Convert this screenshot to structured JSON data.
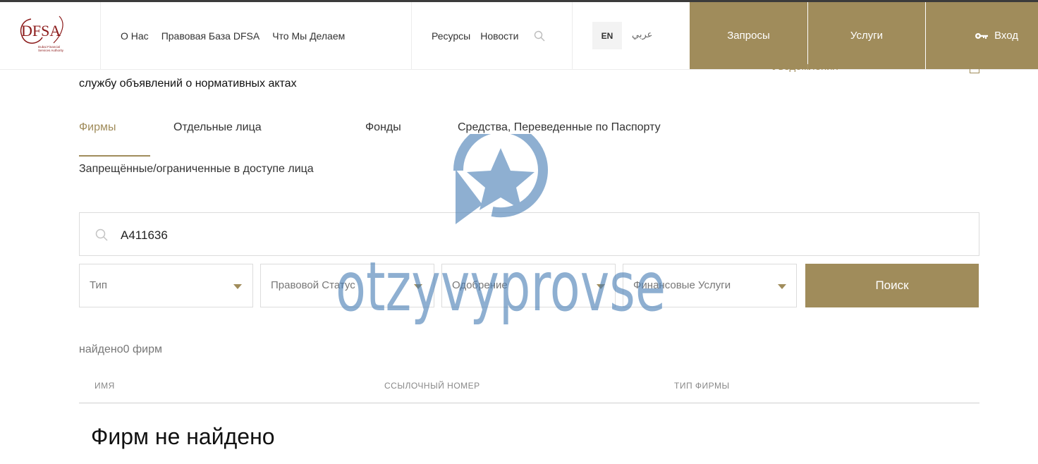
{
  "header": {
    "logo_text": "DFSA",
    "logo_subtext": "Dubai Financial Services Authority",
    "nav_left": [
      "О Нас",
      "Правовая База DFSA",
      "Что Мы Делаем"
    ],
    "nav_mid": [
      "Ресурсы",
      "Новости"
    ],
    "lang_en": "EN",
    "lang_ar": "عربي",
    "btn_requests": "Запросы",
    "btn_services": "Услуги",
    "btn_login": "Вход"
  },
  "behind_header": {
    "notifications": "Уведомления"
  },
  "subtitle": "службу объявлений о нормативных актах",
  "tabs": [
    "Фирмы",
    "Отдельные лица",
    "Фонды",
    "Средства, Переведенные по Паспорту",
    "Запрещённые/ограниченные в доступе лица"
  ],
  "active_tab": "Фирмы",
  "search": {
    "value": "A411636"
  },
  "filters": {
    "type": "Тип",
    "legal_status": "Правовой Статус",
    "approval": "Одобрение",
    "financial_services": "Финансовые Услуги"
  },
  "search_button": "Поиск",
  "results_count": "найдено0 фирм",
  "table": {
    "columns": [
      "ИМЯ",
      "ССЫЛОЧНЫЙ НОМЕР",
      "ТИП ФИРМЫ"
    ],
    "empty_message": "Фирм не найдено"
  },
  "watermark": "otzyvyprovse",
  "colors": {
    "accent": "#a08c5b",
    "watermark": "#4a7fb5"
  }
}
